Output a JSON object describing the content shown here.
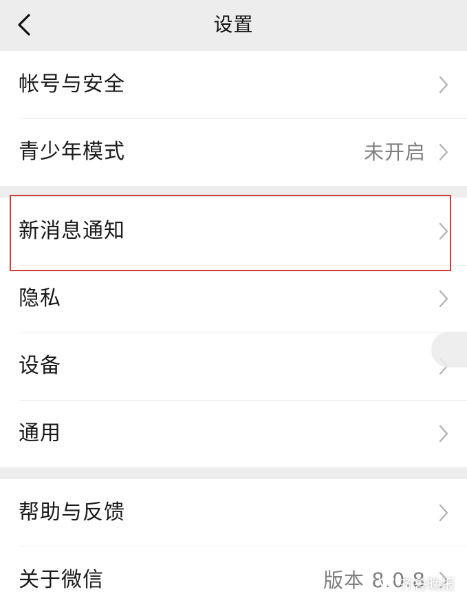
{
  "header": {
    "title": "设置",
    "back_icon": "chevron-left-icon"
  },
  "groups": [
    {
      "items": [
        {
          "label": "帐号与安全",
          "value": ""
        },
        {
          "label": "青少年模式",
          "value": "未开启"
        }
      ]
    },
    {
      "items": [
        {
          "label": "新消息通知",
          "value": ""
        },
        {
          "label": "隐私",
          "value": ""
        },
        {
          "label": "设备",
          "value": ""
        },
        {
          "label": "通用",
          "value": ""
        }
      ]
    },
    {
      "items": [
        {
          "label": "帮助与反馈",
          "value": ""
        },
        {
          "label": "关于微信",
          "value": "版本 8.0.8"
        }
      ]
    }
  ],
  "annotation": {
    "highlighted_item": "新消息通知",
    "color": "#d23a3a"
  },
  "watermark": {
    "text": "齐鲁晚报",
    "icon": "wechat-channel-icon"
  },
  "colors": {
    "background": "#ededed",
    "row_background": "#ffffff",
    "secondary_text": "#808080"
  }
}
